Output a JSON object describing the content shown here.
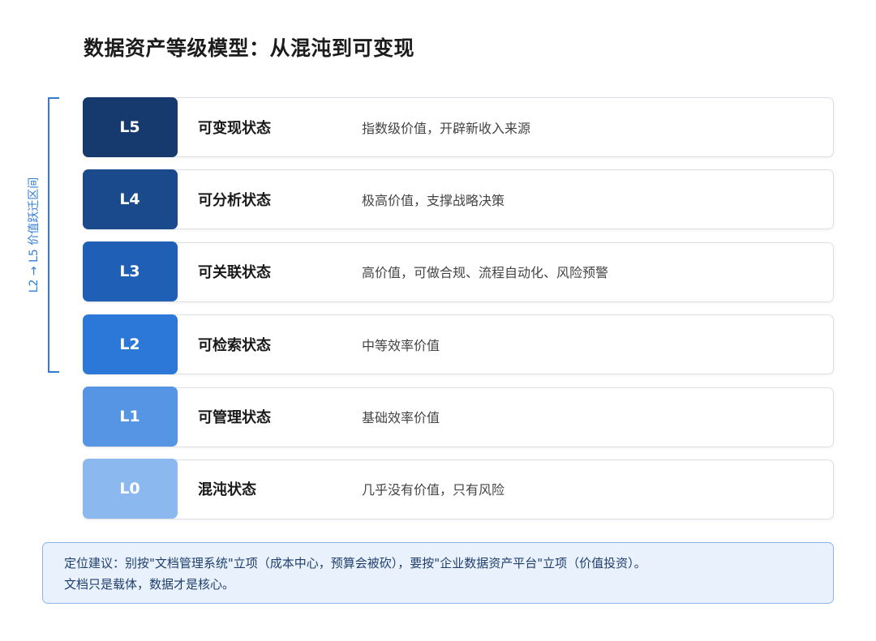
{
  "title": "数据资产等级模型：从混沌到可变现",
  "bracket_label": "L2 → L5 价值跃迁区间",
  "levels": [
    {
      "level": "L5",
      "state": "可变现状态",
      "desc": "指数级价值，开辟新收入来源",
      "color": "#173a6e"
    },
    {
      "level": "L4",
      "state": "可分析状态",
      "desc": "极高价值，支撑战略决策",
      "color": "#1a4a8c"
    },
    {
      "level": "L3",
      "state": "可关联状态",
      "desc": "高价值，可做合规、流程自动化、风险预警",
      "color": "#1f5fb5"
    },
    {
      "level": "L2",
      "state": "可检索状态",
      "desc": "中等效率价值",
      "color": "#2b78d8"
    },
    {
      "level": "L1",
      "state": "可管理状态",
      "desc": "基础效率价值",
      "color": "#5595e3"
    },
    {
      "level": "L0",
      "state": "混沌状态",
      "desc": "几乎没有价值，只有风险",
      "color": "#8cb8f0"
    }
  ],
  "note": {
    "line1": "定位建议：别按\"文档管理系统\"立项（成本中心，预算会被砍），要按\"企业数据资产平台\"立项（价值投资）。",
    "line2": "文档只是载体，数据才是核心。"
  }
}
